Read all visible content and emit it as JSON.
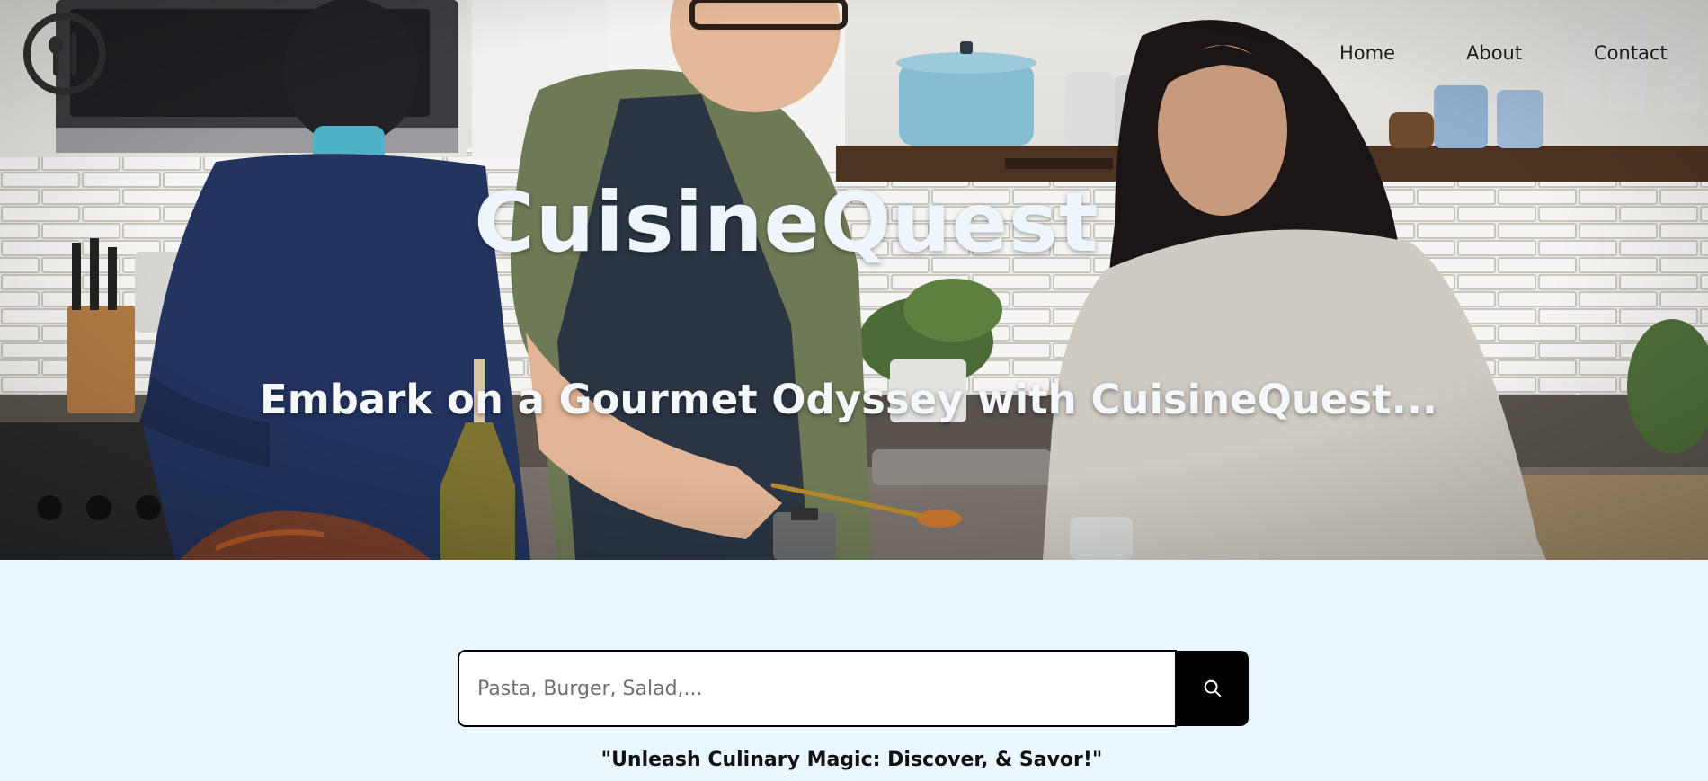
{
  "nav": {
    "home": "Home",
    "about": "About",
    "contact": "Contact"
  },
  "hero": {
    "title": "CuisineQuest",
    "subtitle": "Embark on a Gourmet Odyssey with CuisineQuest..."
  },
  "search": {
    "placeholder": "Pasta, Burger, Salad,...",
    "value": ""
  },
  "tagline": "\"Unleash Culinary Magic: Discover, & Savor!\"",
  "icons": {
    "logo": "spoon-fork-circle-icon",
    "search": "search-icon"
  },
  "colors": {
    "page_background": "#eaf7fe",
    "search_button": "#000000",
    "hero_text": "#eef5fb"
  }
}
